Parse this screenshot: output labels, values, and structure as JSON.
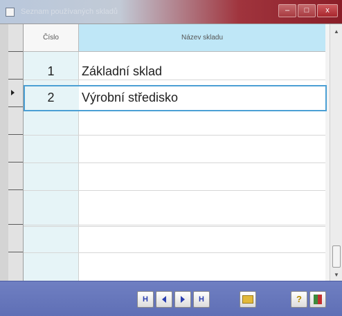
{
  "window": {
    "title": "Seznam používaných skladů",
    "buttons": {
      "minimize": "–",
      "maximize": "□",
      "close": "x"
    }
  },
  "grid": {
    "columns": [
      "Číslo",
      "Název skladu"
    ],
    "rows": [
      {
        "cislo": "1",
        "nazev": "Základní sklad"
      },
      {
        "cislo": "2",
        "nazev": "Výrobní středisko"
      }
    ],
    "selected_row": 2
  },
  "toolbar": {
    "icons": [
      "first-record-icon",
      "prev-record-icon",
      "next-record-icon",
      "last-record-icon",
      "open-folder-icon",
      "help-icon",
      "exit-icon"
    ],
    "help_label": "?",
    "first_glyph": "H",
    "last_glyph": "H"
  },
  "colors": {
    "header_highlight": "#bfe7f7",
    "number_column": "#e6f4f7",
    "selection_border": "#4a9fd4",
    "toolbar": "#6f7fc2"
  }
}
